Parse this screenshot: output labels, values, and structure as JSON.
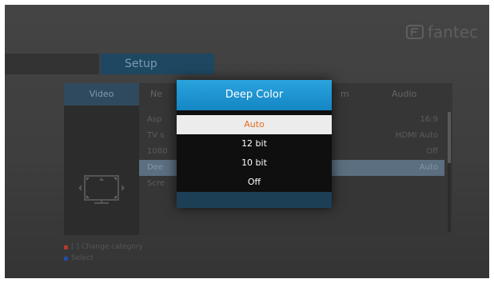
{
  "brand": {
    "logo_text": "fantec"
  },
  "header": {
    "title": "Setup"
  },
  "categories": [
    "Video",
    "Ne",
    "m",
    "Audio"
  ],
  "settings": [
    {
      "label": "Asp",
      "value": "16:9",
      "selected": false
    },
    {
      "label": "TV s",
      "value": "HDMI Auto",
      "selected": false
    },
    {
      "label": "1080",
      "value": "Off",
      "selected": false
    },
    {
      "label": "Dee",
      "value": "Auto",
      "selected": true
    },
    {
      "label": "Scre",
      "value": "",
      "selected": false
    }
  ],
  "legend": {
    "change_category": "[ ] Change category",
    "select": "Select"
  },
  "dialog": {
    "title": "Deep Color",
    "options": [
      "Auto",
      "12 bit",
      "10 bit",
      "Off"
    ],
    "selected": "Auto"
  },
  "colors": {
    "accent": "#1f95d3",
    "selected_text": "#e46d1f",
    "legend_red": "#b53a2a",
    "legend_blue": "#1f4fa5"
  }
}
